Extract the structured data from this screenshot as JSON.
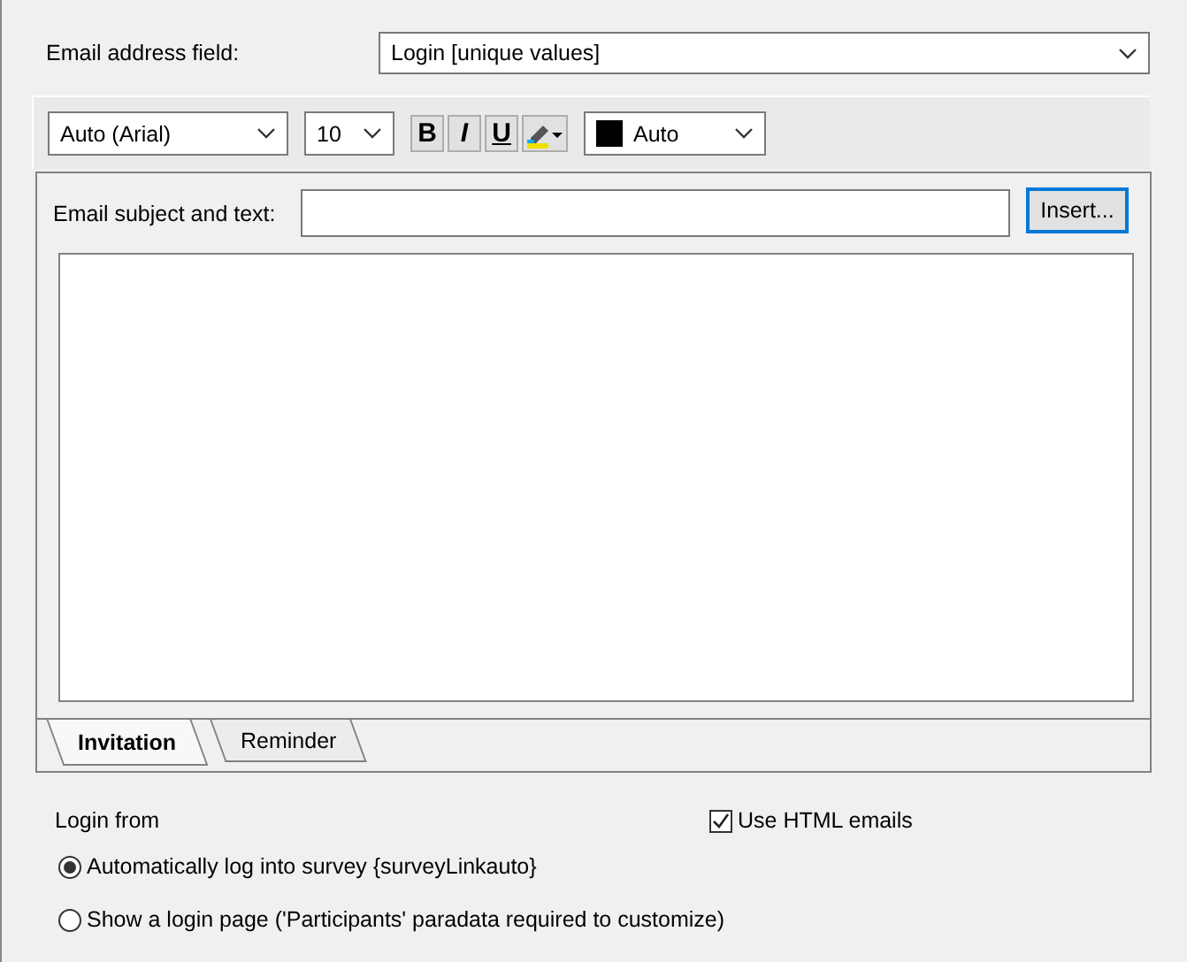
{
  "email_field": {
    "label": "Email address field:",
    "value": "Login [unique values]"
  },
  "toolbar": {
    "font": "Auto (Arial)",
    "size": "10",
    "bold": {
      "label": "B",
      "on": false
    },
    "italic": {
      "label": "I",
      "on": false
    },
    "underline": {
      "label": "U",
      "on": false
    },
    "color": {
      "value": "Auto",
      "color": "#000000"
    }
  },
  "subject": {
    "label": "Email subject and text:"
  },
  "insert_button": "Insert...",
  "tabs": [
    {
      "label": "Invitation",
      "selected": true
    },
    {
      "label": "Reminder",
      "selected": false
    }
  ],
  "login": {
    "label": "Login from",
    "options": [
      {
        "label": "Automatically log into survey {surveyLinkauto}",
        "selected": true
      },
      {
        "label": "Show a login page ('Participants' paradata required to customize)",
        "selected": false
      }
    ]
  },
  "html_emails": {
    "label": "Use HTML emails",
    "checked": true
  }
}
